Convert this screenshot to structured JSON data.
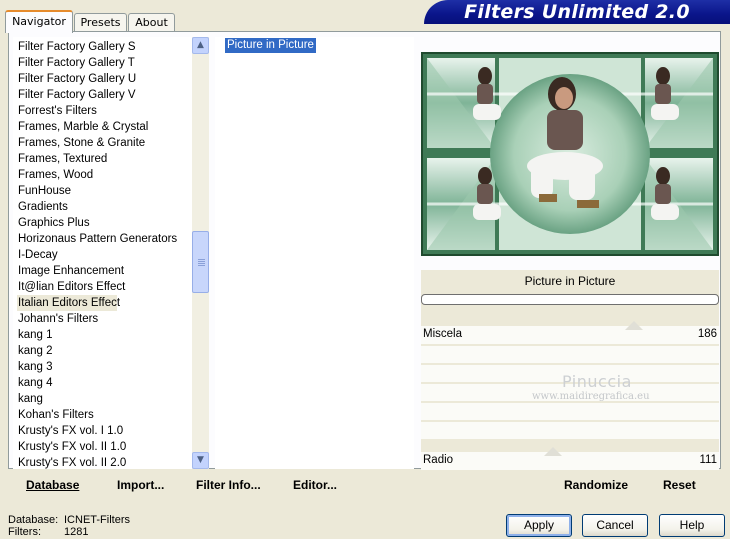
{
  "tabs": [
    "Navigator",
    "Presets",
    "About"
  ],
  "banner_title": "Filters Unlimited 2.0",
  "filter_list": [
    "Filter Factory Gallery S",
    "Filter Factory Gallery T",
    "Filter Factory Gallery U",
    "Filter Factory Gallery V",
    "Forrest's Filters",
    "Frames, Marble & Crystal",
    "Frames, Stone & Granite",
    "Frames, Textured",
    "Frames, Wood",
    "FunHouse",
    "Gradients",
    "Graphics Plus",
    "Horizonaus Pattern Generators",
    "I-Decay",
    "Image Enhancement",
    "It@lian Editors Effect",
    "Italian Editors Effect",
    "Johann's Filters",
    "kang 1",
    "kang 2",
    "kang 3",
    "kang 4",
    "kang",
    "Kohan's Filters",
    "Krusty's FX vol. I 1.0",
    "Krusty's FX vol. II 1.0",
    "Krusty's FX vol. II 2.0"
  ],
  "selected_filter": "Italian Editors Effect",
  "effects": [
    "Picture in Picture"
  ],
  "selected_effect": "Picture in Picture",
  "param_title": "Picture in Picture",
  "sliders": [
    {
      "label": "Miscela",
      "value": "186",
      "level": 0.73
    },
    {
      "label": "Radio",
      "value": "111",
      "level": 0.44
    }
  ],
  "watermark": {
    "name": "Pinuccia",
    "site": "www.maidiregrafica.eu"
  },
  "toolbar": {
    "database": "Database",
    "import": "Import...",
    "filter_info": "Filter Info...",
    "editor": "Editor...",
    "randomize": "Randomize",
    "reset": "Reset"
  },
  "status": {
    "database_label": "Database:",
    "database_value": "ICNET-Filters",
    "filters_label": "Filters:",
    "filters_value": "1281"
  },
  "buttons": {
    "apply": "Apply",
    "cancel": "Cancel",
    "help": "Help"
  },
  "colors": {
    "banner": "#0a158a",
    "selection": "#316ac5",
    "preview_green": "#2e5a3c"
  }
}
